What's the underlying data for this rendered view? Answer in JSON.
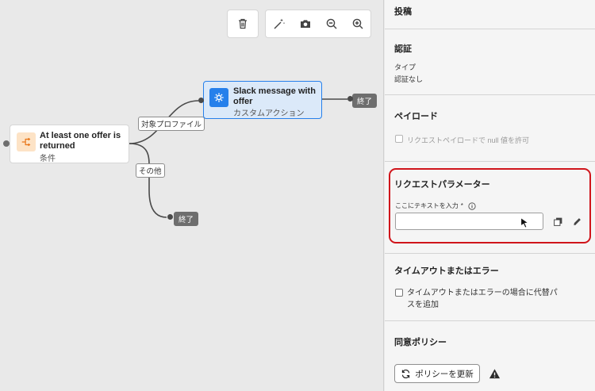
{
  "canvas": {
    "toolbar": {
      "delete_icon": "trash-icon",
      "tools": [
        "magic-wand-icon",
        "camera-icon",
        "zoom-out-icon",
        "zoom-in-icon"
      ]
    },
    "condition_node": {
      "title_line1": "At least one offer is",
      "title_line2": "returned",
      "subtitle": "条件",
      "path_label_1": "対象プロファイル",
      "path_label_2": "その他"
    },
    "action_node": {
      "title_line1": "Slack message with",
      "title_line2": "offer",
      "subtitle": "カスタムアクション"
    },
    "end_label": "終了"
  },
  "panel": {
    "post": {
      "label": "投稿"
    },
    "auth": {
      "title": "認証",
      "type_label": "タイプ",
      "type_value": "認証なし"
    },
    "payload": {
      "title": "ペイロード",
      "allow_null_label": "リクエストペイロードで null 値を許可",
      "allow_null_checked": false
    },
    "request_params": {
      "title": "リクエストパラメーター",
      "field_label": "ここにテキストを入力",
      "required_mark": "*",
      "value": ""
    },
    "timeout": {
      "title": "タイムアウトまたはエラー",
      "option_line1": "タイムアウトまたはエラーの場合に代替パ",
      "option_line2": "スを追加",
      "checked": false
    },
    "consent": {
      "title": "同意ポリシー",
      "update_button": "ポリシーを更新"
    }
  },
  "colors": {
    "accent_action": "#2680eb",
    "condition_icon_bg": "#fde3c6",
    "condition_icon": "#e8761a",
    "highlight_border": "#d0151b"
  }
}
